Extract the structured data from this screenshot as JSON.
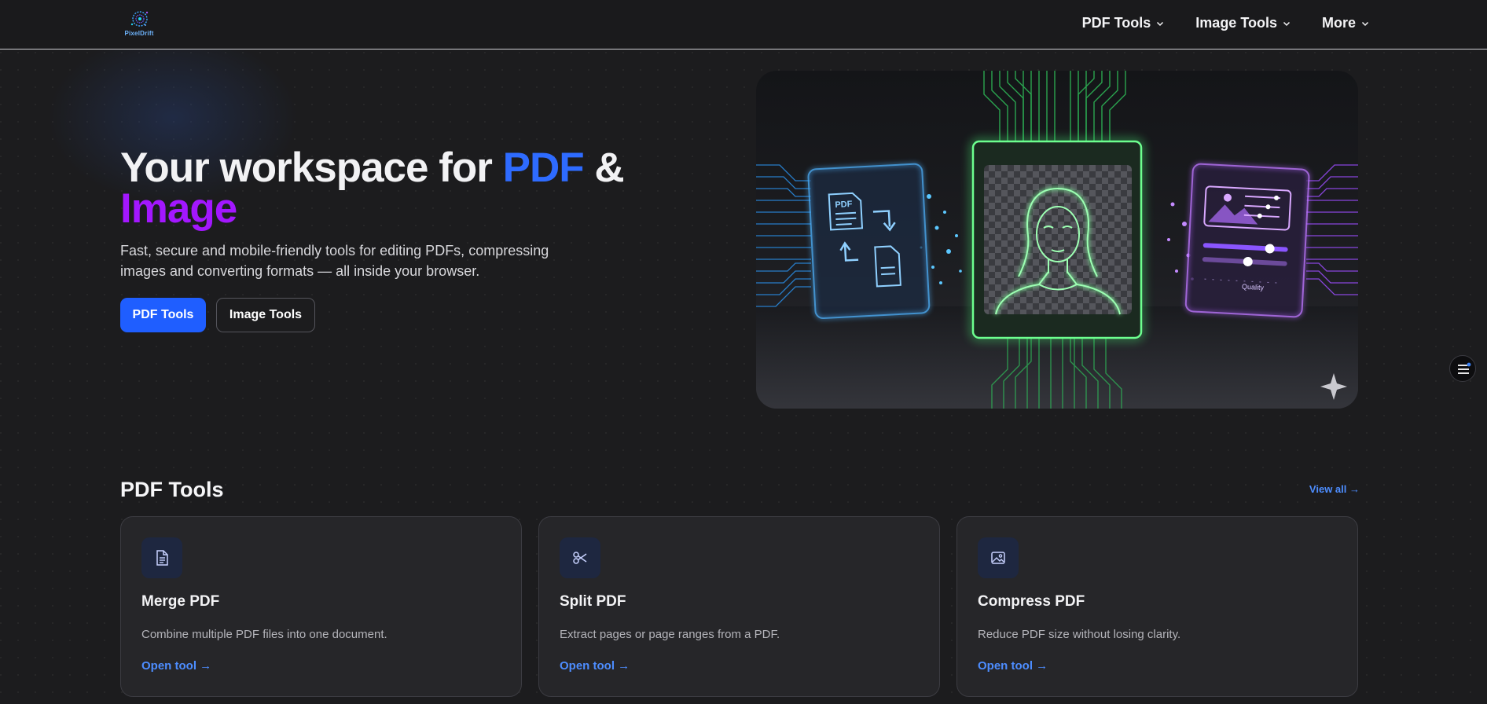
{
  "brand": {
    "logo_text": "PixelDrift"
  },
  "nav": {
    "items": [
      {
        "label": "PDF Tools"
      },
      {
        "label": "Image Tools"
      },
      {
        "label": "More"
      }
    ]
  },
  "hero": {
    "title_part1": "Your workspace for ",
    "title_pdf": "PDF",
    "title_amp": " &",
    "title_image": "Image",
    "subtitle": "Fast, secure and mobile-friendly tools for editing PDFs, compressing images and converting formats — all inside your browser.",
    "primary_button": "PDF Tools",
    "secondary_button": "Image Tools",
    "illustration": {
      "pdf_label": "PDF",
      "quality_label": "Quality"
    }
  },
  "section": {
    "title": "PDF Tools",
    "view_all": "View all →",
    "cards": [
      {
        "icon": "document-icon",
        "title": "Merge PDF",
        "desc": "Combine multiple PDF files into one document.",
        "link": "Open tool →"
      },
      {
        "icon": "scissors-icon",
        "title": "Split PDF",
        "desc": "Extract pages or page ranges from a PDF.",
        "link": "Open tool →"
      },
      {
        "icon": "image-icon",
        "title": "Compress PDF",
        "desc": "Reduce PDF size without losing clarity.",
        "link": "Open tool →"
      }
    ]
  },
  "colors": {
    "accent_blue": "#1f5eff",
    "title_blue": "#2e6bff",
    "title_purple": "#a317ff",
    "link_blue": "#4d8dff",
    "background": "#1c1c1e"
  }
}
